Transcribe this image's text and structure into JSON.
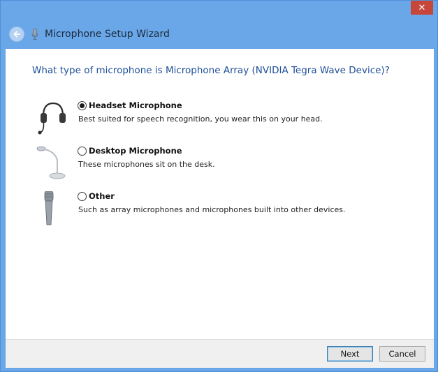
{
  "window": {
    "close_glyph": "✕",
    "title": "Microphone Setup Wizard",
    "back_icon": "back-arrow-icon",
    "title_icon": "microphone-icon"
  },
  "question": "What type of microphone is Microphone Array (NVIDIA Tegra Wave Device)?",
  "options": [
    {
      "label": "Headset Microphone",
      "description": "Best suited for speech recognition, you wear this on your head.",
      "selected": true,
      "icon": "headset-icon"
    },
    {
      "label": "Desktop Microphone",
      "description": "These microphones sit on the desk.",
      "selected": false,
      "icon": "desktop-microphone-icon"
    },
    {
      "label": "Other",
      "description": "Such as array microphones and microphones built into other devices.",
      "selected": false,
      "icon": "handheld-microphone-icon"
    }
  ],
  "buttons": {
    "next": "Next",
    "cancel": "Cancel"
  },
  "colors": {
    "frame": "#6aa7e8",
    "close": "#c7463a",
    "question_text": "#1f4f9a"
  }
}
